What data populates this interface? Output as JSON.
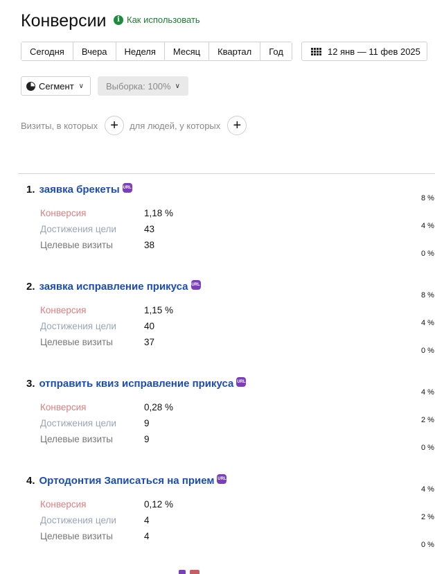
{
  "header": {
    "title": "Конверсии",
    "help_label": "Как использовать"
  },
  "periods": [
    "Сегодня",
    "Вчера",
    "Неделя",
    "Месяц",
    "Квартал",
    "Год"
  ],
  "date_range": "12 янв — 11 фев 2025",
  "segment_label": "Сегмент",
  "sample_label": "Выборка: 100%",
  "filter": {
    "visits_label": "Визиты, в которых",
    "people_label": "для людей, у которых"
  },
  "metric_labels": {
    "conversion": "Конверсия",
    "reaches": "Достижения цели",
    "visits": "Целевые визиты"
  },
  "goals": [
    {
      "num": "1.",
      "name": "заявка брекеты",
      "conversion": "1,18 %",
      "reaches": "43",
      "visits": "38",
      "axis": [
        "8 %",
        "4 %",
        "0 %"
      ]
    },
    {
      "num": "2.",
      "name": "заявка исправление прикуса",
      "conversion": "1,15 %",
      "reaches": "40",
      "visits": "37",
      "axis": [
        "8 %",
        "4 %",
        "0 %"
      ]
    },
    {
      "num": "3.",
      "name": "отправить квиз исправление прикуса",
      "conversion": "0,28 %",
      "reaches": "9",
      "visits": "9",
      "axis": [
        "4 %",
        "2 %",
        "0 %"
      ]
    },
    {
      "num": "4.",
      "name": "Ортодонтия Записаться на прием",
      "conversion": "0,12 %",
      "reaches": "4",
      "visits": "4",
      "axis": [
        "4 %",
        "2 %",
        "0 %"
      ]
    }
  ],
  "colors": {
    "goal_link": "#1a4cb4",
    "url_badge": "#7b3fb8",
    "conversion_label": "#d98080",
    "reaches_label": "#9aa6b8",
    "help_icon": "#1f8a3b"
  },
  "icons": {
    "help": "info-icon",
    "date": "calendar-grid-icon",
    "segment": "pie-icon",
    "goal_type": "url-icon"
  }
}
